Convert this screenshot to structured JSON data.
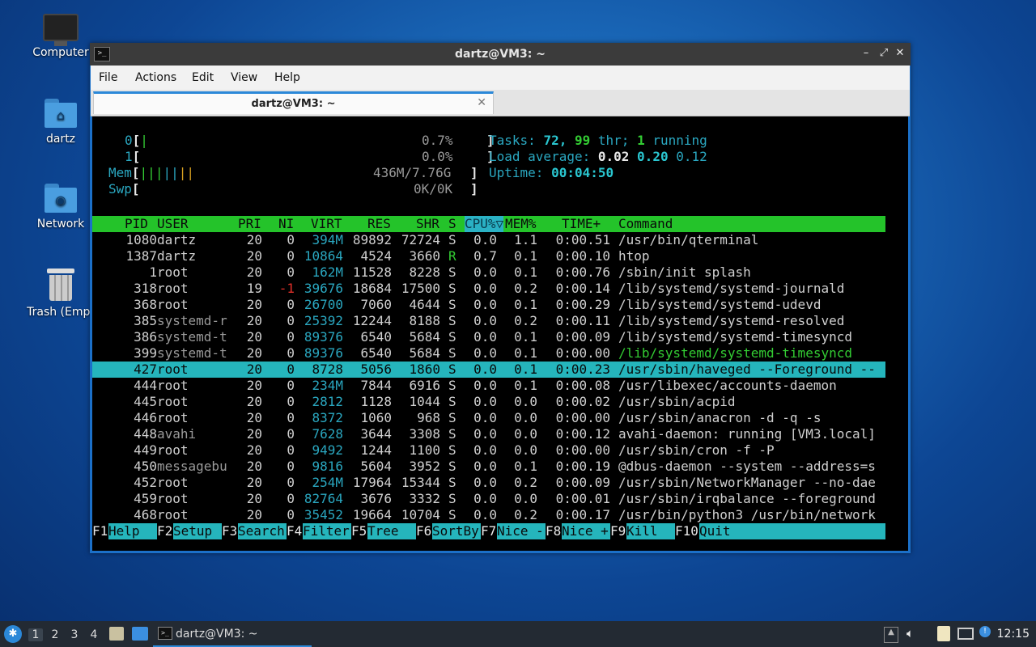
{
  "desktop": {
    "icons": [
      {
        "label": "Computer"
      },
      {
        "label": "dartz"
      },
      {
        "label": "Network"
      },
      {
        "label": "Trash (Empt"
      }
    ]
  },
  "window": {
    "title": "dartz@VM3: ~",
    "menu": [
      "File",
      "Actions",
      "Edit",
      "View",
      "Help"
    ],
    "tab_label": "dartz@VM3: ~"
  },
  "htop": {
    "meters": {
      "cpu0": {
        "label": "0",
        "percent": "0.7%"
      },
      "cpu1": {
        "label": "1",
        "percent": "0.0%"
      },
      "mem": {
        "label": "Mem",
        "value": "436M/7.76G"
      },
      "swp": {
        "label": "Swp",
        "value": "0K/0K"
      }
    },
    "summary": {
      "tasks_label": "Tasks:",
      "tasks": "72,",
      "threads": "99",
      "thr_label": "thr;",
      "running": "1",
      "running_label": "running",
      "load_label": "Load average:",
      "load1": "0.02",
      "load5": "0.20",
      "load15": "0.12",
      "uptime_label": "Uptime:",
      "uptime": "00:04:50"
    },
    "columns": [
      "PID",
      "USER",
      "PRI",
      "NI",
      "VIRT",
      "RES",
      "SHR",
      "S",
      "CPU%▽",
      "MEM%",
      "TIME+",
      "Command"
    ],
    "rows": [
      {
        "pid": "1080",
        "user": "dartz",
        "pri": "20",
        "ni": "0",
        "virt": "394M",
        "res": "89892",
        "shr": "72724",
        "s": "S",
        "cpu": "0.0",
        "mem": "1.1",
        "time": "0:00.51",
        "cmd": "/usr/bin/qterminal"
      },
      {
        "pid": "1387",
        "user": "dartz",
        "pri": "20",
        "ni": "0",
        "virt": "10864",
        "res": "4524",
        "shr": "3660",
        "s": "R",
        "cpu": "0.7",
        "mem": "0.1",
        "time": "0:00.10",
        "cmd": "htop"
      },
      {
        "pid": "1",
        "user": "root",
        "pri": "20",
        "ni": "0",
        "virt": "162M",
        "res": "11528",
        "shr": "8228",
        "s": "S",
        "cpu": "0.0",
        "mem": "0.1",
        "time": "0:00.76",
        "cmd": "/sbin/init splash"
      },
      {
        "pid": "318",
        "user": "root",
        "pri": "19",
        "ni": "-1",
        "virt": "39676",
        "res": "18684",
        "shr": "17500",
        "s": "S",
        "cpu": "0.0",
        "mem": "0.2",
        "time": "0:00.14",
        "cmd": "/lib/systemd/systemd-journald"
      },
      {
        "pid": "368",
        "user": "root",
        "pri": "20",
        "ni": "0",
        "virt": "26700",
        "res": "7060",
        "shr": "4644",
        "s": "S",
        "cpu": "0.0",
        "mem": "0.1",
        "time": "0:00.29",
        "cmd": "/lib/systemd/systemd-udevd"
      },
      {
        "pid": "385",
        "user": "systemd-r",
        "pri": "20",
        "ni": "0",
        "virt": "25392",
        "res": "12244",
        "shr": "8188",
        "s": "S",
        "cpu": "0.0",
        "mem": "0.2",
        "time": "0:00.11",
        "cmd": "/lib/systemd/systemd-resolved"
      },
      {
        "pid": "386",
        "user": "systemd-t",
        "pri": "20",
        "ni": "0",
        "virt": "89376",
        "res": "6540",
        "shr": "5684",
        "s": "S",
        "cpu": "0.0",
        "mem": "0.1",
        "time": "0:00.09",
        "cmd": "/lib/systemd/systemd-timesyncd"
      },
      {
        "pid": "399",
        "user": "systemd-t",
        "pri": "20",
        "ni": "0",
        "virt": "89376",
        "res": "6540",
        "shr": "5684",
        "s": "S",
        "cpu": "0.0",
        "mem": "0.1",
        "time": "0:00.00",
        "cmd": "/lib/systemd/systemd-timesyncd"
      },
      {
        "pid": "427",
        "user": "root",
        "pri": "20",
        "ni": "0",
        "virt": "8728",
        "res": "5056",
        "shr": "1860",
        "s": "S",
        "cpu": "0.0",
        "mem": "0.1",
        "time": "0:00.23",
        "cmd": "/usr/sbin/haveged --Foreground --"
      },
      {
        "pid": "444",
        "user": "root",
        "pri": "20",
        "ni": "0",
        "virt": "234M",
        "res": "7844",
        "shr": "6916",
        "s": "S",
        "cpu": "0.0",
        "mem": "0.1",
        "time": "0:00.08",
        "cmd": "/usr/libexec/accounts-daemon"
      },
      {
        "pid": "445",
        "user": "root",
        "pri": "20",
        "ni": "0",
        "virt": "2812",
        "res": "1128",
        "shr": "1044",
        "s": "S",
        "cpu": "0.0",
        "mem": "0.0",
        "time": "0:00.02",
        "cmd": "/usr/sbin/acpid"
      },
      {
        "pid": "446",
        "user": "root",
        "pri": "20",
        "ni": "0",
        "virt": "8372",
        "res": "1060",
        "shr": "968",
        "s": "S",
        "cpu": "0.0",
        "mem": "0.0",
        "time": "0:00.00",
        "cmd": "/usr/sbin/anacron -d -q -s"
      },
      {
        "pid": "448",
        "user": "avahi",
        "pri": "20",
        "ni": "0",
        "virt": "7628",
        "res": "3644",
        "shr": "3308",
        "s": "S",
        "cpu": "0.0",
        "mem": "0.0",
        "time": "0:00.12",
        "cmd": "avahi-daemon: running [VM3.local]"
      },
      {
        "pid": "449",
        "user": "root",
        "pri": "20",
        "ni": "0",
        "virt": "9492",
        "res": "1244",
        "shr": "1100",
        "s": "S",
        "cpu": "0.0",
        "mem": "0.0",
        "time": "0:00.00",
        "cmd": "/usr/sbin/cron -f -P"
      },
      {
        "pid": "450",
        "user": "messagebu",
        "pri": "20",
        "ni": "0",
        "virt": "9816",
        "res": "5604",
        "shr": "3952",
        "s": "S",
        "cpu": "0.0",
        "mem": "0.1",
        "time": "0:00.19",
        "cmd": "@dbus-daemon --system --address=s"
      },
      {
        "pid": "452",
        "user": "root",
        "pri": "20",
        "ni": "0",
        "virt": "254M",
        "res": "17964",
        "shr": "15344",
        "s": "S",
        "cpu": "0.0",
        "mem": "0.2",
        "time": "0:00.09",
        "cmd": "/usr/sbin/NetworkManager --no-dae"
      },
      {
        "pid": "459",
        "user": "root",
        "pri": "20",
        "ni": "0",
        "virt": "82764",
        "res": "3676",
        "shr": "3332",
        "s": "S",
        "cpu": "0.0",
        "mem": "0.0",
        "time": "0:00.01",
        "cmd": "/usr/sbin/irqbalance --foreground"
      },
      {
        "pid": "468",
        "user": "root",
        "pri": "20",
        "ni": "0",
        "virt": "35452",
        "res": "19664",
        "shr": "10704",
        "s": "S",
        "cpu": "0.0",
        "mem": "0.2",
        "time": "0:00.17",
        "cmd": "/usr/bin/python3 /usr/bin/network"
      }
    ],
    "selected_pid": "427",
    "fkeys": [
      {
        "key": "F1",
        "label": "Help"
      },
      {
        "key": "F2",
        "label": "Setup"
      },
      {
        "key": "F3",
        "label": "Search"
      },
      {
        "key": "F4",
        "label": "Filter"
      },
      {
        "key": "F5",
        "label": "Tree"
      },
      {
        "key": "F6",
        "label": "SortBy"
      },
      {
        "key": "F7",
        "label": "Nice -"
      },
      {
        "key": "F8",
        "label": "Nice +"
      },
      {
        "key": "F9",
        "label": "Kill"
      },
      {
        "key": "F10",
        "label": "Quit"
      }
    ]
  },
  "taskbar": {
    "workspaces": [
      "1",
      "2",
      "3",
      "4"
    ],
    "task_label": "dartz@VM3: ~",
    "clock": "12:15"
  }
}
